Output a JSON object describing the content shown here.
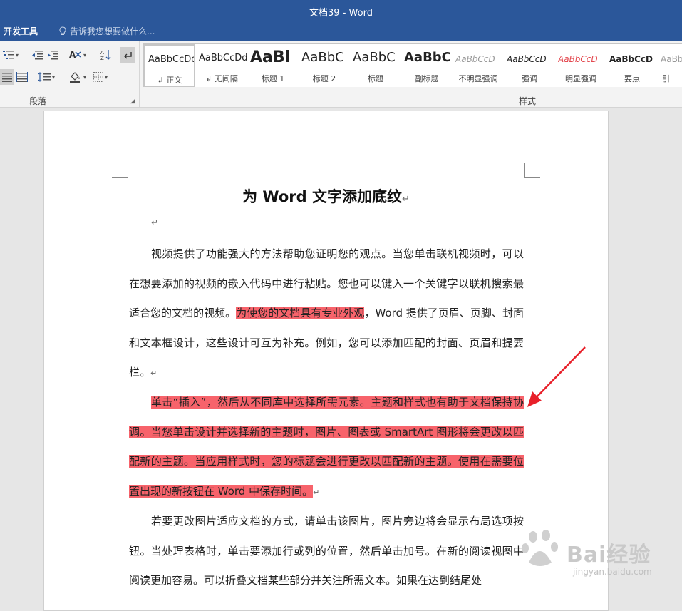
{
  "window": {
    "title": "文档39 - Word"
  },
  "tabs": {
    "developer": "开发工具",
    "tell_me": "告诉我您想要做什么..."
  },
  "ribbon": {
    "paragraph_group_label": "段落",
    "styles_group_label": "样式",
    "styles": [
      {
        "preview": "AaBbCcDd",
        "label": "↲ 正文"
      },
      {
        "preview": "AaBbCcDd",
        "label": "↲ 无间隔"
      },
      {
        "preview": "AaBl",
        "label": "标题 1"
      },
      {
        "preview": "AaBbC",
        "label": "标题 2"
      },
      {
        "preview": "AaBbC",
        "label": "标题"
      },
      {
        "preview": "AaBbC",
        "label": "副标题"
      },
      {
        "preview": "AaBbCcD",
        "label": "不明显强调"
      },
      {
        "preview": "AaBbCcD",
        "label": "强调"
      },
      {
        "preview": "AaBbCcD",
        "label": "明显强调"
      },
      {
        "preview": "AaBbCcD",
        "label": "要点"
      },
      {
        "preview": "AaBbCcD",
        "label": "引"
      }
    ]
  },
  "document": {
    "title": "为 Word 文字添加底纹",
    "para1_plain": "视频提供了功能强大的方法帮助您证明您的观点。当您单击联机视频时，可以在想要添加的视频的嵌入代码中进行粘贴。您也可以键入一个关键字以联机搜索最适合您的文档的视频。",
    "para1_highlight": "为使您的文档具有专业外观",
    "para1_rest": "，Word 提供了页眉、页脚、封面和文本框设计，这些设计可互为补充。例如，您可以添加匹配的封面、页眉和提要栏。",
    "para2_highlight": "单击“插入”，然后从不同库中选择所需元素。主题和样式也有助于文档保持协调。当您单击设计并选择新的主题时，图片、图表或 SmartArt 图形将会更改以匹配新的主题。当应用样式时，您的标题会进行更改以匹配新的主题。使用在需要位置出现的新按钮在 Word 中保存时间。",
    "para3": "若要更改图片适应文档的方式，请单击该图片，图片旁边将会显示布局选项按钮。当处理表格时，单击要添加行或列的位置，然后单击加号。在新的阅读视图中阅读更加容易。可以折叠文档某些部分并关注所需文本。如果在达到结尾处",
    "paragraph_mark": "↵"
  },
  "watermark": {
    "text": "Bai经验",
    "sub": "jingyan.baidu.com"
  },
  "colors": {
    "title_bar": "#2b579a",
    "highlight": "#f7636b",
    "arrow": "#e8202a"
  }
}
